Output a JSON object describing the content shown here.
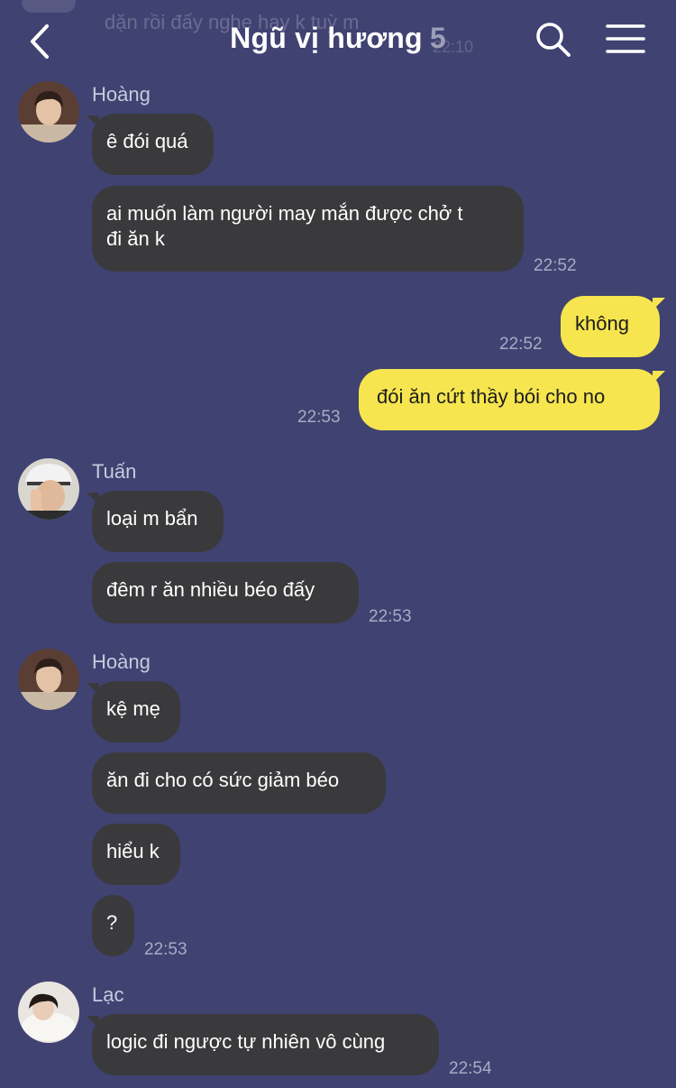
{
  "colors": {
    "background": "#404272",
    "incoming_bubble": "#3a3a3c",
    "outgoing_bubble": "#f6e54e"
  },
  "ghost": {
    "text": "dặn rồi đấy nghe hay k tuỳ m",
    "time": "22:10"
  },
  "header": {
    "title": "Ngũ vị hương",
    "member_count": "5",
    "icons": [
      "chevron-left-icon",
      "search-icon",
      "menu-icon"
    ]
  },
  "messages": {
    "hoang1": {
      "sender": "Hoàng",
      "b1": "ê đói quá",
      "b2_line1": "ai muốn làm người may mắn được chở t",
      "b2_line2": "đi ăn k",
      "time": "22:52"
    },
    "me1": {
      "text": "không",
      "time": "22:52"
    },
    "me2": {
      "text": "đói ăn cứt thầy bói cho no",
      "time": "22:53"
    },
    "tuan": {
      "sender": "Tuấn",
      "b1": "loại m bẩn",
      "b2": "đêm r ăn nhiều béo đấy",
      "time": "22:53"
    },
    "hoang2": {
      "sender": "Hoàng",
      "b1": "kệ mẹ",
      "b2": "ăn đi cho có sức giảm béo",
      "b3": "hiểu k",
      "b4": "?",
      "time": "22:53"
    },
    "lac": {
      "sender": "Lạc",
      "b1": "logic đi ngược tự nhiên vô cùng",
      "time": "22:54"
    }
  }
}
